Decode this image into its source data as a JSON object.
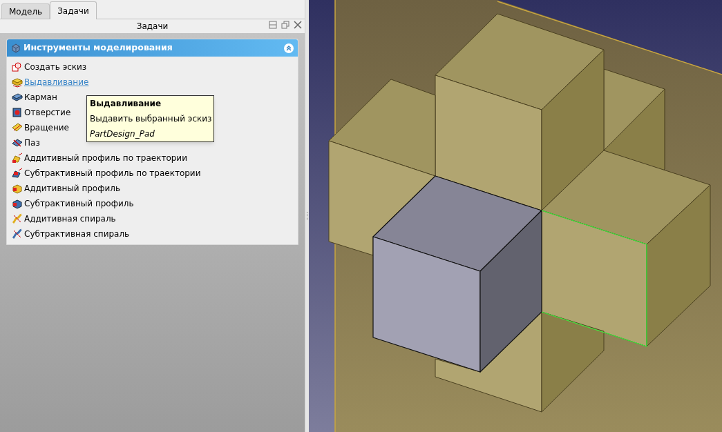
{
  "tabs": [
    {
      "label": "Модель",
      "selected": false
    },
    {
      "label": "Задачи",
      "selected": true
    }
  ],
  "panel_title": "Задачи",
  "section": {
    "title": "Инструменты моделирования",
    "expanded": true
  },
  "items": [
    {
      "label": "Создать эскиз",
      "hovered": false
    },
    {
      "label": "Выдавливание",
      "hovered": true
    },
    {
      "label": "Карман",
      "hovered": false
    },
    {
      "label": "Отверстие",
      "hovered": false
    },
    {
      "label": "Вращение",
      "hovered": false
    },
    {
      "label": "Паз",
      "hovered": false
    },
    {
      "label": "Аддитивный профиль по траектории",
      "hovered": false
    },
    {
      "label": "Субтрактивный профиль по траектории",
      "hovered": false
    },
    {
      "label": "Аддитивный профиль",
      "hovered": false
    },
    {
      "label": "Субтрактивный профиль",
      "hovered": false
    },
    {
      "label": "Аддитивная спираль",
      "hovered": false
    },
    {
      "label": "Субтрактивная спираль",
      "hovered": false
    }
  ],
  "tooltip": {
    "title": "Выдавливание",
    "description": "Выдавить выбранный эскиз",
    "command": "PartDesign_Pad"
  }
}
